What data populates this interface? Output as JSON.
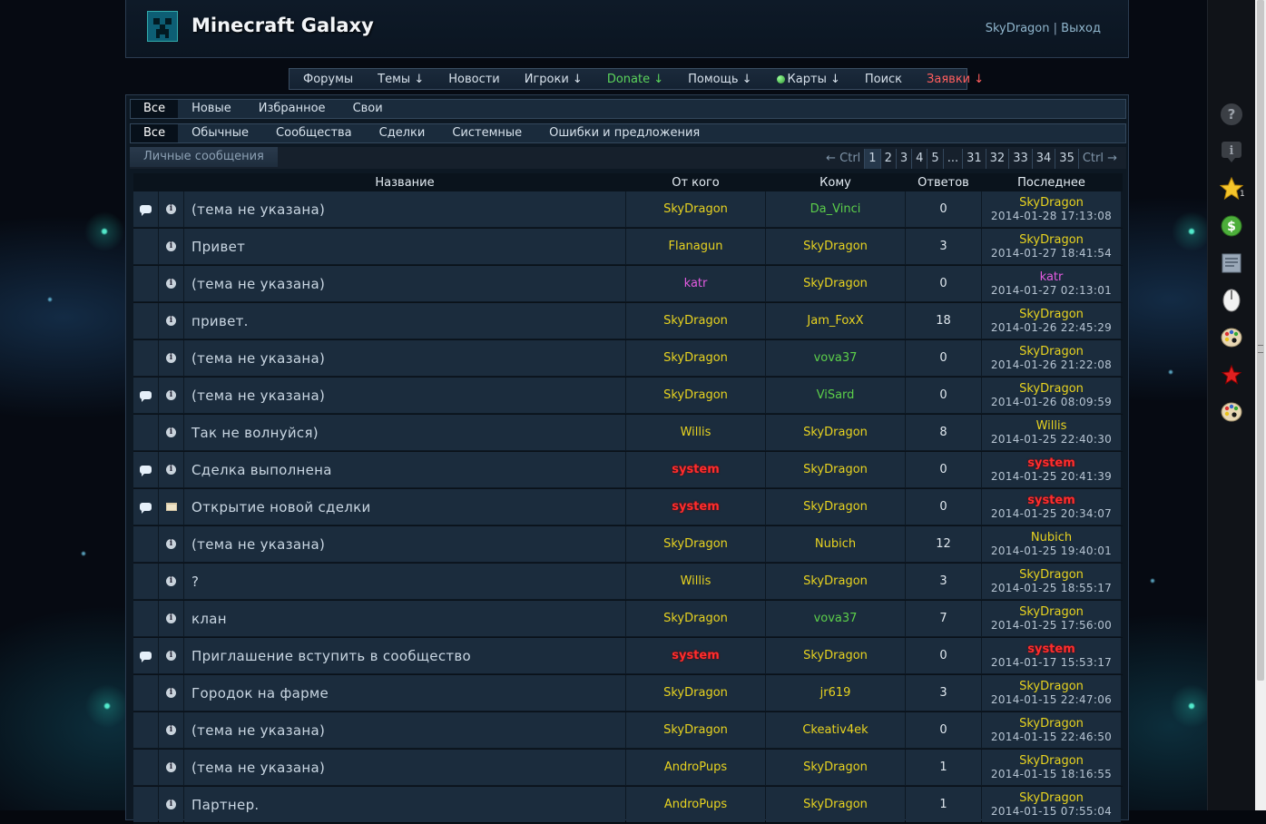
{
  "header": {
    "title": "Minecraft Galaxy",
    "user": "SkyDragon",
    "separator": "|",
    "logout": "Выход"
  },
  "nav": [
    {
      "label": "Форумы",
      "color": "default"
    },
    {
      "label": "Темы ↓",
      "color": "default"
    },
    {
      "label": "Новости",
      "color": "default"
    },
    {
      "label": "Игроки ↓",
      "color": "default"
    },
    {
      "label": "Donate ↓",
      "color": "green"
    },
    {
      "label": "Помощь ↓",
      "color": "default"
    },
    {
      "label": "Карты ↓",
      "color": "default",
      "icon": "globe-icon"
    },
    {
      "label": "Поиск",
      "color": "default"
    },
    {
      "label": "Заявки ↓",
      "color": "red"
    }
  ],
  "tabs1": [
    "Все",
    "Новые",
    "Избранное",
    "Свои"
  ],
  "tabs2": [
    "Все",
    "Обычные",
    "Сообщества",
    "Сделки",
    "Системные",
    "Ошибки и предложения"
  ],
  "pm_label": "Личные сообщения",
  "pager": {
    "prev": "← Ctrl",
    "pages": [
      "1",
      "2",
      "3",
      "4",
      "5",
      "...",
      "31",
      "32",
      "33",
      "34",
      "35"
    ],
    "current": "1",
    "next": "Ctrl →"
  },
  "columns": {
    "title": "Название",
    "from": "От кого",
    "to": "Кому",
    "answers": "Ответов",
    "last": "Последнее"
  },
  "colors": {
    "yellow": "#e8d320",
    "green": "#5ccf4a",
    "pink": "#e35be0",
    "red": "#ff2d2d"
  },
  "rows": [
    {
      "bubble": true,
      "type": "info",
      "title": "(тема не указана)",
      "from": "SkyDragon",
      "fromColor": "yellow",
      "to": "Da_Vinci",
      "toColor": "green",
      "answers": "0",
      "lastUser": "SkyDragon",
      "lastColor": "yellow",
      "lastDate": "2014-01-28 17:13:08"
    },
    {
      "bubble": false,
      "type": "info",
      "title": "Привет",
      "from": "Flanagun",
      "fromColor": "yellow",
      "to": "SkyDragon",
      "toColor": "yellow",
      "answers": "3",
      "lastUser": "SkyDragon",
      "lastColor": "yellow",
      "lastDate": "2014-01-27 18:41:54"
    },
    {
      "bubble": false,
      "type": "info",
      "title": "(тема не указана)",
      "from": "katr",
      "fromColor": "pink",
      "to": "SkyDragon",
      "toColor": "yellow",
      "answers": "0",
      "lastUser": "katr",
      "lastColor": "pink",
      "lastDate": "2014-01-27 02:13:01"
    },
    {
      "bubble": false,
      "type": "info",
      "title": "привет.",
      "from": "SkyDragon",
      "fromColor": "yellow",
      "to": "Jam_FoxX",
      "toColor": "yellow",
      "answers": "18",
      "lastUser": "SkyDragon",
      "lastColor": "yellow",
      "lastDate": "2014-01-26 22:45:29"
    },
    {
      "bubble": false,
      "type": "info",
      "title": "(тема не указана)",
      "from": "SkyDragon",
      "fromColor": "yellow",
      "to": "vova37",
      "toColor": "green",
      "answers": "0",
      "lastUser": "SkyDragon",
      "lastColor": "yellow",
      "lastDate": "2014-01-26 21:22:08"
    },
    {
      "bubble": true,
      "type": "info",
      "title": "(тема не указана)",
      "from": "SkyDragon",
      "fromColor": "yellow",
      "to": "ViSard",
      "toColor": "green",
      "answers": "0",
      "lastUser": "SkyDragon",
      "lastColor": "yellow",
      "lastDate": "2014-01-26 08:09:59"
    },
    {
      "bubble": false,
      "type": "info",
      "title": "Так не волнуйся)",
      "from": "Willis",
      "fromColor": "yellow",
      "to": "SkyDragon",
      "toColor": "yellow",
      "answers": "8",
      "lastUser": "Willis",
      "lastColor": "yellow",
      "lastDate": "2014-01-25 22:40:30"
    },
    {
      "bubble": true,
      "type": "info",
      "title": "Сделка выполнена",
      "from": "system",
      "fromColor": "red",
      "to": "SkyDragon",
      "toColor": "yellow",
      "answers": "0",
      "lastUser": "system",
      "lastColor": "red",
      "lastDate": "2014-01-25 20:41:39"
    },
    {
      "bubble": true,
      "type": "cart",
      "title": "Открытие новой сделки",
      "from": "system",
      "fromColor": "red",
      "to": "SkyDragon",
      "toColor": "yellow",
      "answers": "0",
      "lastUser": "system",
      "lastColor": "red",
      "lastDate": "2014-01-25 20:34:07"
    },
    {
      "bubble": false,
      "type": "info",
      "title": "(тема не указана)",
      "from": "SkyDragon",
      "fromColor": "yellow",
      "to": "Nubich",
      "toColor": "yellow",
      "answers": "12",
      "lastUser": "Nubich",
      "lastColor": "yellow",
      "lastDate": "2014-01-25 19:40:01"
    },
    {
      "bubble": false,
      "type": "info",
      "title": "?",
      "from": "Willis",
      "fromColor": "yellow",
      "to": "SkyDragon",
      "toColor": "yellow",
      "answers": "3",
      "lastUser": "SkyDragon",
      "lastColor": "yellow",
      "lastDate": "2014-01-25 18:55:17"
    },
    {
      "bubble": false,
      "type": "info",
      "title": "клан",
      "from": "SkyDragon",
      "fromColor": "yellow",
      "to": "vova37",
      "toColor": "green",
      "answers": "7",
      "lastUser": "SkyDragon",
      "lastColor": "yellow",
      "lastDate": "2014-01-25 17:56:00"
    },
    {
      "bubble": true,
      "type": "info",
      "title": "Приглашение вступить в сообщество",
      "from": "system",
      "fromColor": "red",
      "to": "SkyDragon",
      "toColor": "yellow",
      "answers": "0",
      "lastUser": "system",
      "lastColor": "red",
      "lastDate": "2014-01-17 15:53:17"
    },
    {
      "bubble": false,
      "type": "info",
      "title": "Городок на фарме",
      "from": "SkyDragon",
      "fromColor": "yellow",
      "to": "jr619",
      "toColor": "yellow",
      "answers": "3",
      "lastUser": "SkyDragon",
      "lastColor": "yellow",
      "lastDate": "2014-01-15 22:47:06"
    },
    {
      "bubble": false,
      "type": "info",
      "title": "(тема не указана)",
      "from": "SkyDragon",
      "fromColor": "yellow",
      "to": "Ckeativ4ek",
      "toColor": "yellow",
      "answers": "0",
      "lastUser": "SkyDragon",
      "lastColor": "yellow",
      "lastDate": "2014-01-15 22:46:50"
    },
    {
      "bubble": false,
      "type": "info",
      "title": "(тема не указана)",
      "from": "AndroPups",
      "fromColor": "yellow",
      "to": "SkyDragon",
      "toColor": "yellow",
      "answers": "1",
      "lastUser": "SkyDragon",
      "lastColor": "yellow",
      "lastDate": "2014-01-15 18:16:55"
    },
    {
      "bubble": false,
      "type": "info",
      "title": "Партнер.",
      "from": "AndroPups",
      "fromColor": "yellow",
      "to": "SkyDragon",
      "toColor": "yellow",
      "answers": "1",
      "lastUser": "SkyDragon",
      "lastColor": "yellow",
      "lastDate": "2014-01-15 07:55:04"
    }
  ],
  "sidebar_icons": [
    "help-icon",
    "info-icon",
    "star-icon",
    "dollar-icon",
    "document-icon",
    "mouse-icon",
    "palette-icon",
    "red-star-icon",
    "palette-icon"
  ],
  "sidebar_badge": "1"
}
